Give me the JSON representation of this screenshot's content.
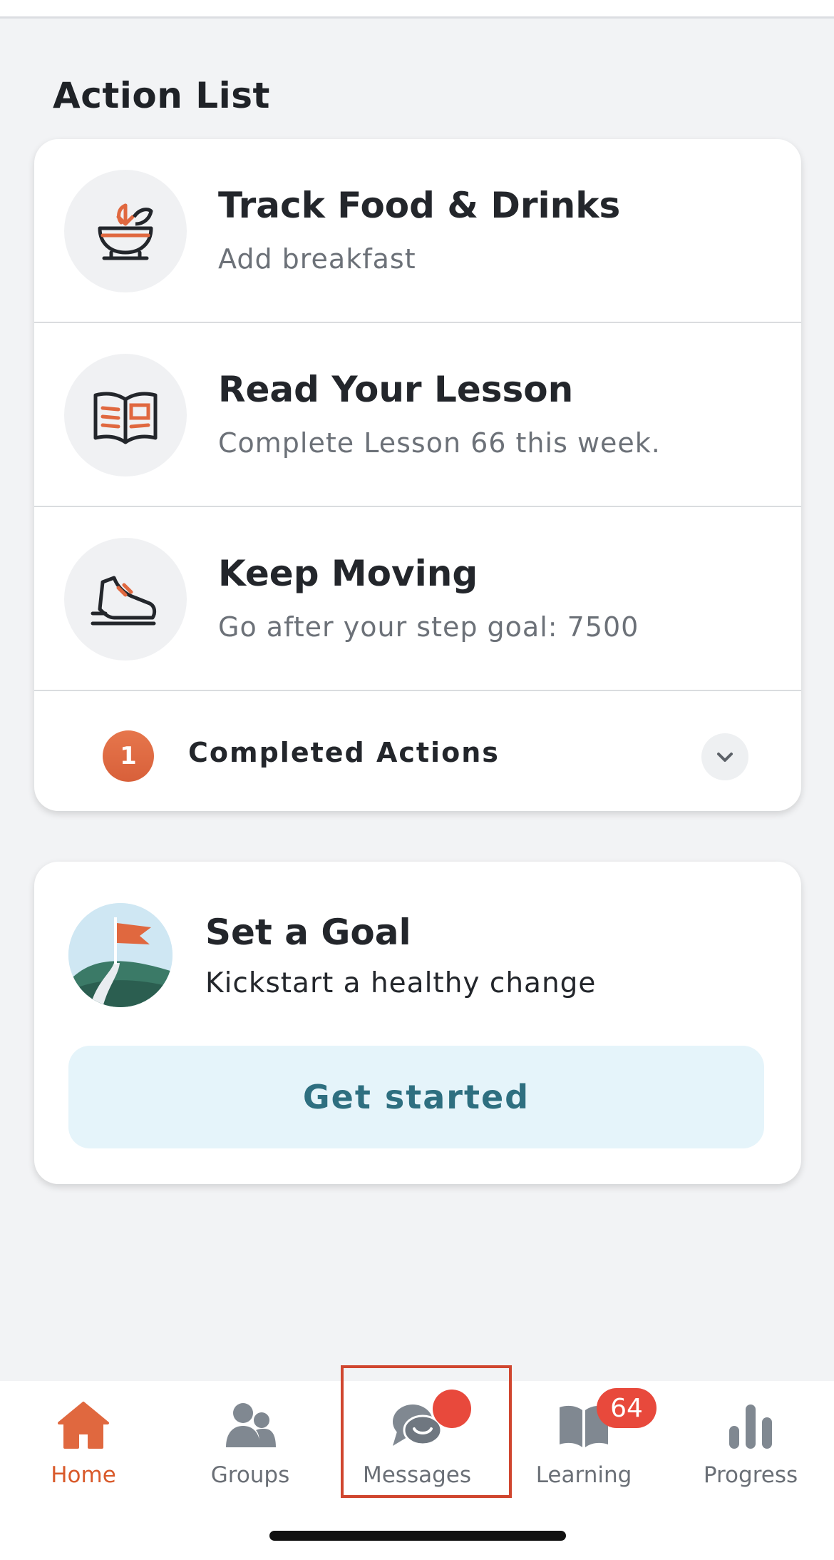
{
  "section": {
    "title": "Action List"
  },
  "actions": [
    {
      "icon": "food-bowl-icon",
      "title": "Track Food & Drinks",
      "subtitle": "Add breakfast"
    },
    {
      "icon": "book-icon",
      "title": "Read Your Lesson",
      "subtitle": "Complete Lesson 66 this week."
    },
    {
      "icon": "sneaker-icon",
      "title": "Keep Moving",
      "subtitle": "Go after your step goal: 7500"
    }
  ],
  "completed": {
    "count": "1",
    "label": "Completed Actions",
    "icon": "chevron-down-icon"
  },
  "goal": {
    "icon": "flag-hill-icon",
    "title": "Set a Goal",
    "subtitle": "Kickstart a healthy change",
    "cta_label": "Get started"
  },
  "tabs": [
    {
      "label": "Home",
      "icon": "home-icon",
      "active": true
    },
    {
      "label": "Groups",
      "icon": "groups-icon",
      "active": false
    },
    {
      "label": "Messages",
      "icon": "messages-icon",
      "active": false
    },
    {
      "label": "Learning",
      "icon": "book-open-icon",
      "active": false,
      "badge": "64"
    },
    {
      "label": "Progress",
      "icon": "bar-chart-icon",
      "active": false
    }
  ],
  "colors": {
    "accent": "#d95a2b",
    "badge": "#e8493c",
    "cta_text": "#2e6f80",
    "cta_bg": "#e5f4fa"
  }
}
